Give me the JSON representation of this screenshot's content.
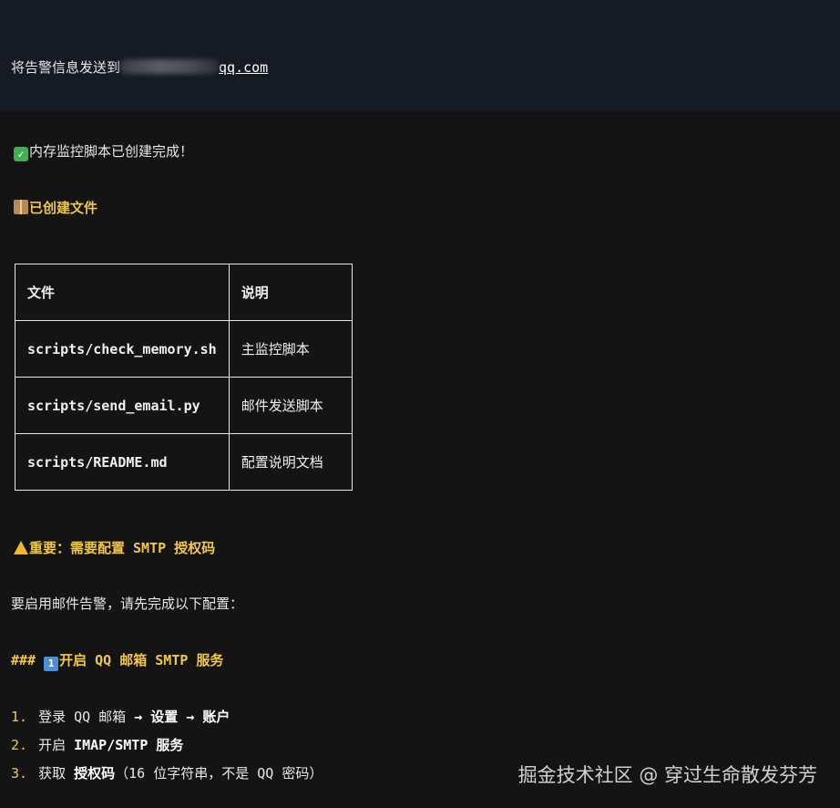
{
  "header": {
    "prefix": "将告警信息发送到",
    "email_suffix": "qq.com"
  },
  "status": {
    "icon": "check-mark-icon",
    "text": "内存监控脚本已创建完成！"
  },
  "created_files": {
    "icon": "package-icon",
    "heading": "已创建文件",
    "columns": [
      "文件",
      "说明"
    ],
    "rows": [
      [
        "scripts/check_memory.sh",
        "主监控脚本"
      ],
      [
        "scripts/send_email.py",
        "邮件发送脚本"
      ],
      [
        "scripts/README.md",
        "配置说明文档"
      ]
    ]
  },
  "important": {
    "icon": "warning-icon",
    "heading": "重要：需要配置 SMTP 授权码",
    "intro": "要启用邮件告警，请先完成以下配置："
  },
  "step1": {
    "hashes": "###",
    "number_icon": "1",
    "heading": "开启 QQ 邮箱 SMTP 服务",
    "items": [
      {
        "num": "1.",
        "a": "登录 QQ 邮箱 ",
        "b": "→ ",
        "c": "设置",
        "d": " → ",
        "e": "账户"
      },
      {
        "num": "2.",
        "a": "开启 ",
        "c": "IMAP/SMTP 服务"
      },
      {
        "num": "3.",
        "a": "获取 ",
        "c": "授权码",
        "d": "（16 位字符串，不是 QQ 密码）"
      }
    ]
  },
  "watermark": "掘金技术社区 @ 穿过生命散发芬芳"
}
